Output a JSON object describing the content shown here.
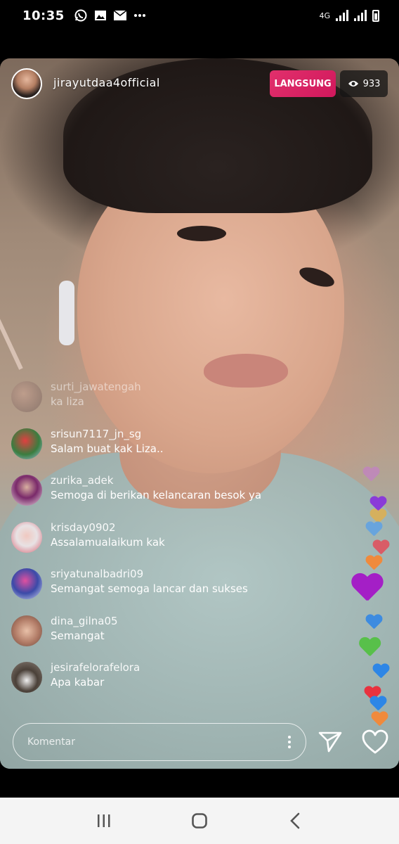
{
  "status_bar": {
    "time": "10:35",
    "network": "4G",
    "notification_icons": [
      "whatsapp-icon",
      "gallery-icon",
      "mail-icon",
      "more-icon"
    ]
  },
  "live": {
    "host_username": "jirayutdaa4official",
    "live_label": "LANGSUNG",
    "viewer_count": "933"
  },
  "comments": [
    {
      "user": "surti_jawatengah",
      "message": "ka liza",
      "avatar_color": "#6d5a56"
    },
    {
      "user": "srisun7117_jn_sg",
      "message": "Salam buat kak Liza..",
      "avatar_color": "#3a7d3f"
    },
    {
      "user": "zurika_adek",
      "message": "Semoga di berikan kelancaran besok ya",
      "avatar_color": "#7a2a6a"
    },
    {
      "user": "krisday0902",
      "message": "Assalamualaikum kak",
      "avatar_color": "#e8e2e4"
    },
    {
      "user": "sriyatunalbadri09",
      "message": "Semangat semoga lancar dan sukses",
      "avatar_color": "#3b4aa8"
    },
    {
      "user": "dina_gilna05",
      "message": "Semangat",
      "avatar_color": "#b07a65"
    },
    {
      "user": "jesirafelorafelora",
      "message": "Apa kabar",
      "avatar_color": "#4a4038"
    }
  ],
  "comment_input": {
    "placeholder": "Komentar"
  },
  "hearts": {
    "colors": [
      "#c77ad0",
      "#8a3bd8",
      "#e3b04a",
      "#5aa0e8",
      "#e34d5a",
      "#f08a3c",
      "#a41fc6",
      "#3d8be0",
      "#58c04a",
      "#2d86e6",
      "#e8323f",
      "#f08a3c"
    ]
  },
  "colors": {
    "live_badge": "#e1306c",
    "nav_bar": "#f4f4f4"
  }
}
